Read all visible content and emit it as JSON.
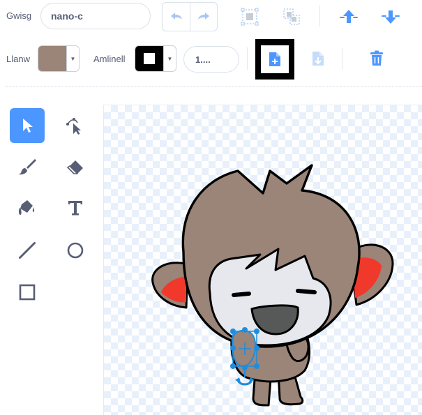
{
  "toolbar": {
    "costume_label": "Gwisg",
    "costume_name": "nano-c",
    "fill_label": "Llanw",
    "outline_label": "Amlinell",
    "outline_width": "1....",
    "fill_color": "#9b8478",
    "outline_color": "#000000",
    "accent_color": "#4c97ff",
    "icons": {
      "undo": "undo-icon",
      "redo": "redo-icon",
      "group": "group-icon",
      "ungroup": "ungroup-icon",
      "forward": "forward-layer-icon",
      "backward": "backward-layer-icon",
      "copy": "copy-icon",
      "paste": "paste-icon",
      "delete": "trash-icon"
    }
  },
  "tools": [
    {
      "name": "select",
      "icon": "arrow-cursor-icon",
      "active": true
    },
    {
      "name": "reshape",
      "icon": "reshape-icon",
      "active": false
    },
    {
      "name": "brush",
      "icon": "brush-icon",
      "active": false
    },
    {
      "name": "eraser",
      "icon": "eraser-icon",
      "active": false
    },
    {
      "name": "fill",
      "icon": "fill-bucket-icon",
      "active": false
    },
    {
      "name": "text",
      "icon": "text-icon",
      "active": false
    },
    {
      "name": "line",
      "icon": "line-icon",
      "active": false
    },
    {
      "name": "circle",
      "icon": "circle-icon",
      "active": false
    },
    {
      "name": "rectangle",
      "icon": "rectangle-icon",
      "active": false
    }
  ],
  "canvas": {
    "character": "monkey-character",
    "selection_color": "#1d8ddf"
  }
}
